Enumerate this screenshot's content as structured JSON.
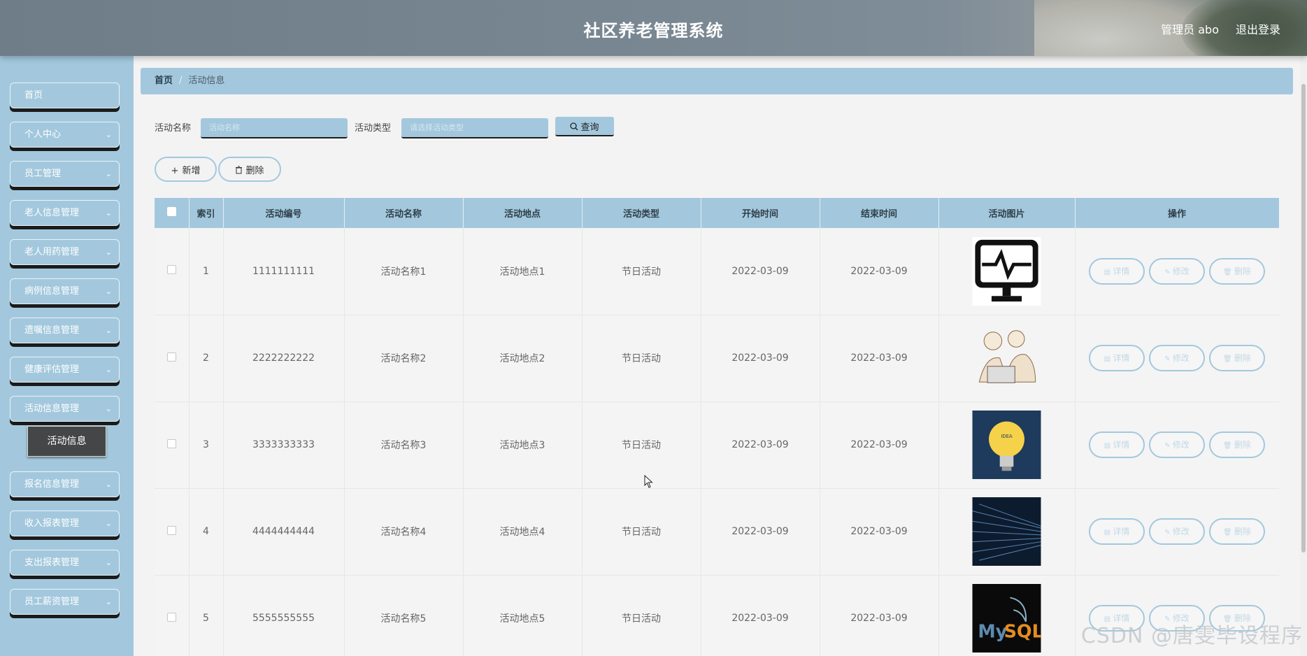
{
  "header": {
    "title": "社区养老管理系统",
    "user": "管理员 abo",
    "logout": "退出登录"
  },
  "sidebar": {
    "items": [
      {
        "label": "首页",
        "chevron": false
      },
      {
        "label": "个人中心",
        "chevron": true
      },
      {
        "label": "员工管理",
        "chevron": true
      },
      {
        "label": "老人信息管理",
        "chevron": true
      },
      {
        "label": "老人用药管理",
        "chevron": true
      },
      {
        "label": "病例信息管理",
        "chevron": true
      },
      {
        "label": "遗嘱信息管理",
        "chevron": true
      },
      {
        "label": "健康评估管理",
        "chevron": true
      },
      {
        "label": "活动信息管理",
        "chevron": true
      },
      {
        "label": "报名信息管理",
        "chevron": true
      },
      {
        "label": "收入报表管理",
        "chevron": true
      },
      {
        "label": "支出报表管理",
        "chevron": true
      },
      {
        "label": "员工薪资管理",
        "chevron": true
      }
    ],
    "submenu": {
      "label": "活动信息"
    }
  },
  "breadcrumb": {
    "home": "首页",
    "separator": "/",
    "current": "活动信息"
  },
  "search": {
    "name_label": "活动名称",
    "name_placeholder": "活动名称",
    "type_label": "活动类型",
    "type_placeholder": "请选择活动类型",
    "query_label": "查询"
  },
  "actions": {
    "add": "新增",
    "delete": "删除"
  },
  "table": {
    "headers": [
      "索引",
      "活动编号",
      "活动名称",
      "活动地点",
      "活动类型",
      "开始时间",
      "结束时间",
      "活动图片",
      "操作"
    ],
    "rows": [
      {
        "index": "1",
        "code": "1111111111",
        "name": "活动名称1",
        "place": "活动地点1",
        "type": "节日活动",
        "start": "2022-03-09",
        "end": "2022-03-09",
        "image": "monitor-heartbeat"
      },
      {
        "index": "2",
        "code": "2222222222",
        "name": "活动名称2",
        "place": "活动地点2",
        "type": "节日活动",
        "start": "2022-03-09",
        "end": "2022-03-09",
        "image": "people-laptop-sketch"
      },
      {
        "index": "3",
        "code": "3333333333",
        "name": "活动名称3",
        "place": "活动地点3",
        "type": "节日活动",
        "start": "2022-03-09",
        "end": "2022-03-09",
        "image": "lightbulb"
      },
      {
        "index": "4",
        "code": "4444444444",
        "name": "活动名称4",
        "place": "活动地点4",
        "type": "节日活动",
        "start": "2022-03-09",
        "end": "2022-03-09",
        "image": "code-stream"
      },
      {
        "index": "5",
        "code": "5555555555",
        "name": "活动名称5",
        "place": "活动地点5",
        "type": "节日活动",
        "start": "2022-03-09",
        "end": "2022-03-09",
        "image": "mysql-logo"
      }
    ],
    "ops": {
      "detail": "详情",
      "edit": "修改",
      "delete": "删除"
    }
  },
  "watermark": "CSDN @唐雯毕设程序",
  "colors": {
    "accent": "#a3c8dd",
    "submenu": "#454647",
    "header": "#76838e"
  }
}
